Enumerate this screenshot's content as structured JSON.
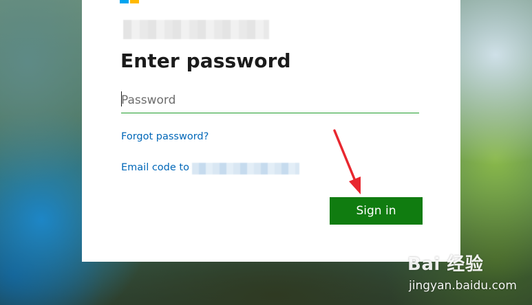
{
  "page": {
    "title": "Enter password"
  },
  "password_field": {
    "placeholder": "Password",
    "value": ""
  },
  "links": {
    "forgot_password": "Forgot password?",
    "email_code": "Email code to"
  },
  "buttons": {
    "sign_in": "Sign in"
  },
  "watermark": {
    "logo_text": "Bai 经验",
    "url": "jingyan.baidu.com"
  },
  "colors": {
    "accent": "#107c10",
    "link": "#0067b8",
    "field_underline": "#1f9e2a",
    "annotation_arrow": "#e8272f",
    "logo_blue": "#00a4ef",
    "logo_yellow": "#ffb900"
  },
  "icons": {
    "brand_logo": "microsoft-logo-icon",
    "annotation": "red-arrow-icon",
    "watermark": "baidu-paw-icon"
  }
}
